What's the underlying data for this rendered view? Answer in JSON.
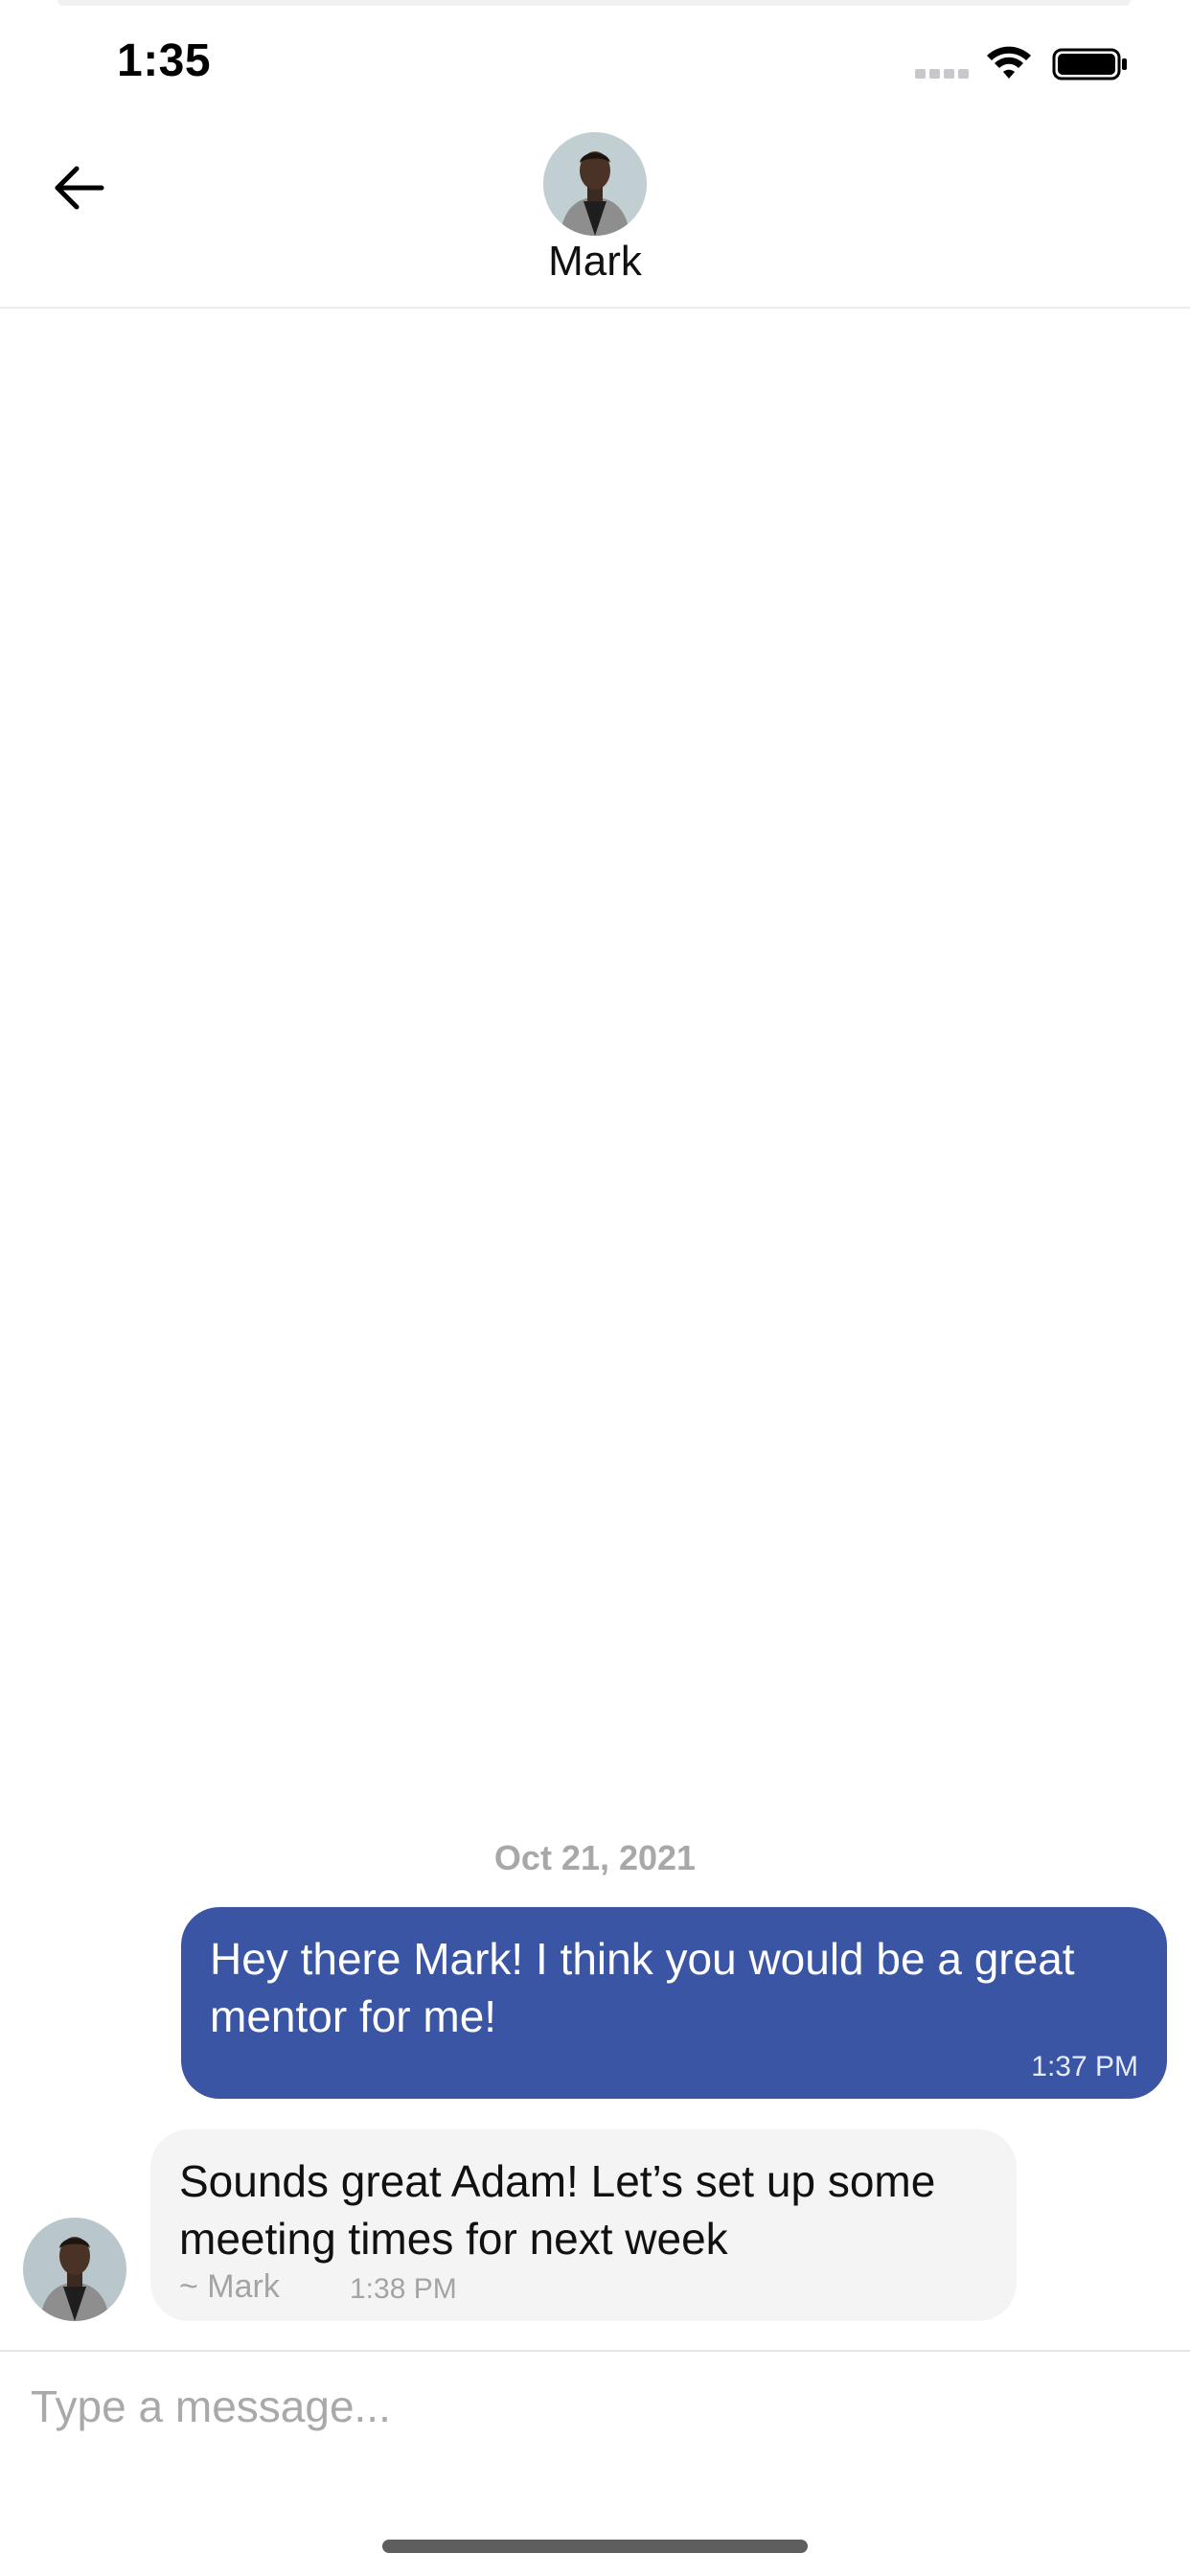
{
  "status_bar": {
    "time": "1:35",
    "icons": [
      "cellular-signal-icon",
      "wifi-icon",
      "battery-icon"
    ]
  },
  "header": {
    "back_icon": "arrow-left-icon",
    "contact_name": "Mark",
    "avatar": "avatar"
  },
  "conversation": {
    "date": "Oct 21, 2021",
    "messages": [
      {
        "direction": "outgoing",
        "text": "Hey there Mark! I think you would be a great mentor for me!",
        "time": "1:37 PM"
      },
      {
        "direction": "incoming",
        "text": "Sounds great Adam! Let’s set up some meeting times for next week",
        "author": "~ Mark",
        "time": "1:38 PM"
      }
    ]
  },
  "composer": {
    "placeholder": "Type a message..."
  },
  "colors": {
    "outgoing_bubble": "#3a55a4",
    "incoming_bubble": "#f4f4f4",
    "muted_text": "#a8a8a8"
  }
}
